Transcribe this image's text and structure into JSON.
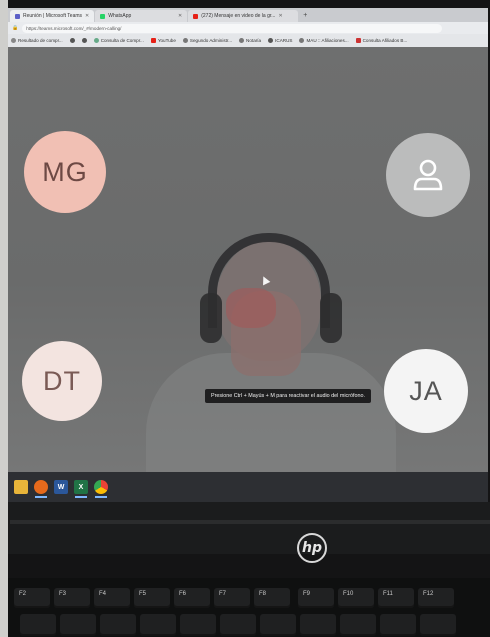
{
  "browser": {
    "tabs": [
      {
        "label": "Reunión | Microsoft Teams",
        "color": "#5b5fc7",
        "active": true
      },
      {
        "label": "WhatsApp",
        "color": "#25d366",
        "active": false
      },
      {
        "label": "(272) Mensaje en video de la gr...",
        "color": "#e62117",
        "active": false
      }
    ],
    "new_tab": "+",
    "url": "https://teams.microsoft.com/_#/modern-calling/",
    "bookmarks": [
      {
        "label": "Resultado de compr...",
        "color": "#888"
      },
      {
        "label": "",
        "color": "#555"
      },
      {
        "label": "",
        "color": "#555"
      },
      {
        "label": "Consulta de Compr...",
        "color": "#6a8"
      },
      {
        "label": "YouTube",
        "color": "#e62117"
      },
      {
        "label": "Segundo Administr...",
        "color": "#777"
      },
      {
        "label": "Notaría",
        "color": "#777"
      },
      {
        "label": "ICARUS",
        "color": "#555"
      },
      {
        "label": "MAU :: Afiliaciones...",
        "color": "#777"
      },
      {
        "label": "Consulta Afiliados B...",
        "color": "#c33"
      }
    ]
  },
  "meeting": {
    "participants": [
      {
        "initials": "MG"
      },
      {
        "initials": ""
      },
      {
        "initials": "DT"
      },
      {
        "initials": "JA"
      }
    ],
    "notification": "Presione Ctrl + Mayús + M para reactivar el audio del micrófono."
  },
  "taskbar": {
    "icons": [
      {
        "name": "file-explorer-icon",
        "color": "#e8b53a"
      },
      {
        "name": "firefox-icon",
        "color": "#e66a1c"
      },
      {
        "name": "word-icon",
        "color": "#2b579a"
      },
      {
        "name": "excel-icon",
        "color": "#217346"
      },
      {
        "name": "chrome-icon",
        "color": "#4285f4"
      }
    ]
  },
  "laptop": {
    "brand": "hp",
    "fkeys": [
      "F2",
      "F3",
      "F4",
      "F5",
      "F6",
      "F7",
      "F8",
      "F9",
      "F10",
      "F11",
      "F12"
    ]
  }
}
